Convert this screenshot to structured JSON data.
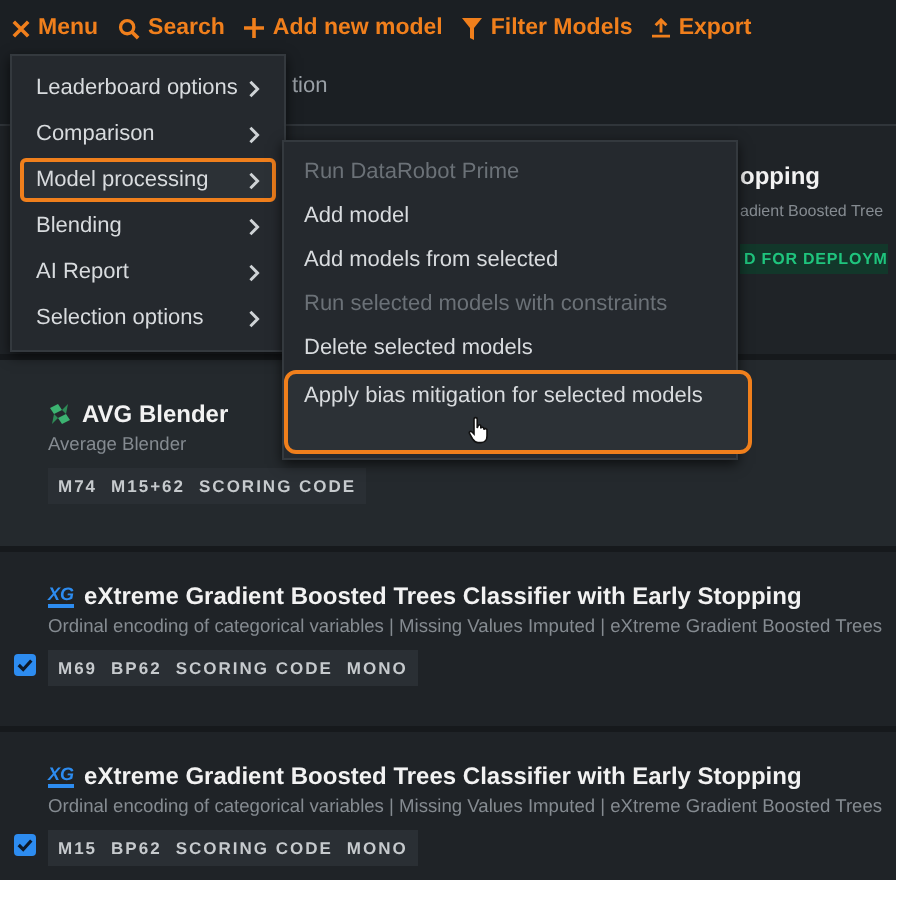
{
  "toolbar": [
    {
      "kind": "close",
      "label": "Menu"
    },
    {
      "kind": "search",
      "label": "Search"
    },
    {
      "kind": "add",
      "label": "Add new model"
    },
    {
      "kind": "filter",
      "label": "Filter Models"
    },
    {
      "kind": "export",
      "label": "Export"
    }
  ],
  "column_header": "tion",
  "partial_row": {
    "title": "opping",
    "subtitle": "adient Boosted Tree",
    "badge": "D FOR DEPLOYM"
  },
  "models": [
    {
      "kind": "blender",
      "title": "AVG Blender",
      "subtitle": "Average Blender",
      "tags": [
        "M74",
        "M15+62",
        "SCORING CODE"
      ]
    },
    {
      "kind": "xgboost",
      "logo": "XG",
      "title": "eXtreme Gradient Boosted Trees Classifier with Early Stopping",
      "subtitle": "Ordinal encoding of categorical variables | Missing Values Imputed | eXtreme Gradient Boosted Trees",
      "checked": true,
      "tags": [
        "M69",
        "BP62",
        "SCORING CODE",
        "MONO"
      ]
    },
    {
      "kind": "xgboost",
      "logo": "XG",
      "title": "eXtreme Gradient Boosted Trees Classifier with Early Stopping",
      "subtitle": "Ordinal encoding of categorical variables | Missing Values Imputed | eXtreme Gradient Boosted Trees",
      "checked": true,
      "tags": [
        "M15",
        "BP62",
        "SCORING CODE",
        "MONO"
      ]
    }
  ],
  "menu": [
    {
      "label": "Leaderboard options",
      "selected": false
    },
    {
      "label": "Comparison",
      "selected": false
    },
    {
      "label": "Model processing",
      "selected": true
    },
    {
      "label": "Blending",
      "selected": false
    },
    {
      "label": "AI Report",
      "selected": false
    },
    {
      "label": "Selection options",
      "selected": false
    }
  ],
  "submenu": [
    {
      "label": "Run DataRobot Prime",
      "disabled": true,
      "selected": false
    },
    {
      "label": "Add model",
      "disabled": false,
      "selected": false
    },
    {
      "label": "Add models from selected",
      "disabled": false,
      "selected": false
    },
    {
      "label": "Run selected models with constraints",
      "disabled": true,
      "selected": false
    },
    {
      "label": "Delete selected models",
      "disabled": false,
      "selected": false
    },
    {
      "label": "Apply bias mitigation for selected models",
      "disabled": false,
      "selected": true
    }
  ]
}
